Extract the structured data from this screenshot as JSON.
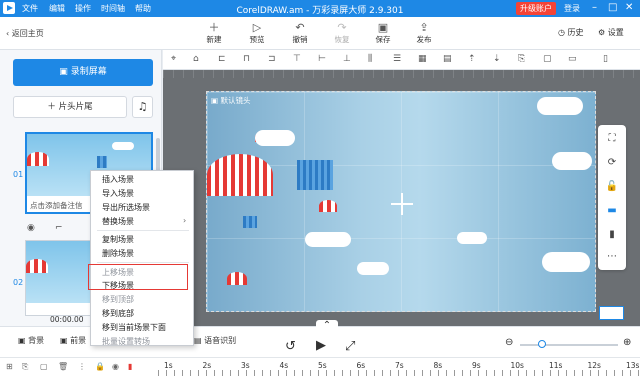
{
  "titlebar": {
    "menus": [
      "文件",
      "编辑",
      "操作",
      "时间轴",
      "帮助"
    ],
    "title": "CorelDRAW.am - 万彩录屏大师 2.9.301",
    "upgrade": "升级账户",
    "login": "登录"
  },
  "toolbar": {
    "back": "返回主页",
    "buttons": [
      {
        "label": "新建",
        "icon": "plus-icon"
      },
      {
        "label": "预览",
        "icon": "preview-icon"
      },
      {
        "label": "撤销",
        "icon": "undo-icon"
      },
      {
        "label": "恢复",
        "icon": "redo-icon"
      },
      {
        "label": "保存",
        "icon": "save-icon"
      },
      {
        "label": "发布",
        "icon": "publish-icon"
      }
    ],
    "history": "历史",
    "settings": "设置"
  },
  "left": {
    "record": "录制屏幕",
    "head_tail": "片头片尾",
    "scenes": [
      {
        "num": "01",
        "caption": "点击添加备注信"
      },
      {
        "num": "02",
        "caption": ""
      }
    ],
    "timecode": "00:00.00"
  },
  "canvas": {
    "camera_label": "默认镜头"
  },
  "context_menu": {
    "items": [
      "插入场景",
      "导入场景",
      "导出所选场景",
      "替换场景",
      "复制场景",
      "删除场景",
      "上移场景",
      "下移场景",
      "移到顶部",
      "移到底部",
      "移到当前场景下面",
      "批量设置转场"
    ],
    "disabled": [
      "上移场景",
      "移到顶部",
      "批量设置转场"
    ]
  },
  "bottom": {
    "tabs": [
      "背景",
      "前景",
      "语音识别"
    ],
    "zoom": 0
  },
  "timeline": {
    "ticks": [
      "1s",
      "2s",
      "3s",
      "4s",
      "5s",
      "6s",
      "7s",
      "8s",
      "9s",
      "10s",
      "11s",
      "12s",
      "13s"
    ]
  },
  "colors": {
    "accent": "#1e88e5",
    "upgrade": "#f44336",
    "highlight": "#e53935"
  }
}
